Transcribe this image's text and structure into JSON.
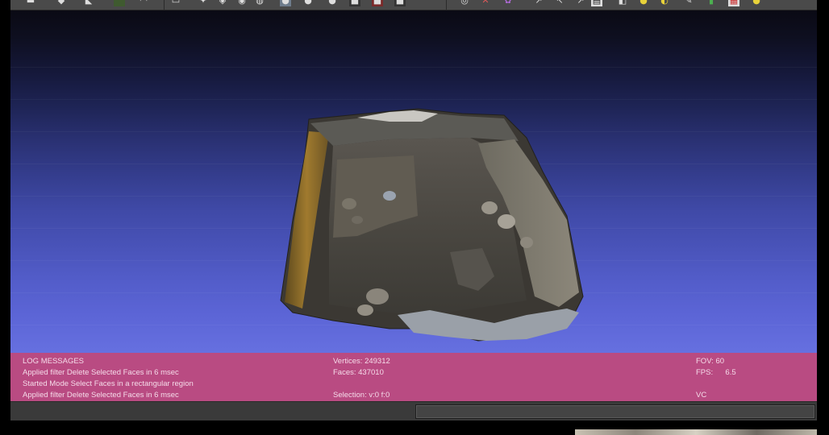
{
  "toolbar": {
    "icons": [
      "new-icon",
      "open-icon",
      "save-icon",
      "layers-icon",
      "snapshot-icon",
      "import-icon",
      "filter-icon",
      "lighting-icon",
      "shading-icon",
      "trackball-icon",
      "select-icon",
      "measure-icon",
      "paint-icon",
      "color-icon",
      "annotate-icon",
      "info-icon"
    ]
  },
  "log": {
    "header": "LOG MESSAGES",
    "lines": [
      "Applied filter Delete Selected Faces in 6 msec",
      "Started Mode Select Faces in a rectangular region",
      "Applied filter Delete Selected Faces in 6 msec"
    ]
  },
  "mesh_stats": {
    "vertices": "Vertices: 249312",
    "faces": "Faces: 437010",
    "selection": "Selection: v:0 f:0"
  },
  "view_stats": {
    "fov": "FOV: 60",
    "fps_label": "FPS:",
    "fps_value": "6.5",
    "vc": "VC"
  },
  "colors": {
    "info_bar": "#b94b82",
    "viewport_top": "#0a0a14",
    "viewport_bottom": "#6670e0"
  }
}
